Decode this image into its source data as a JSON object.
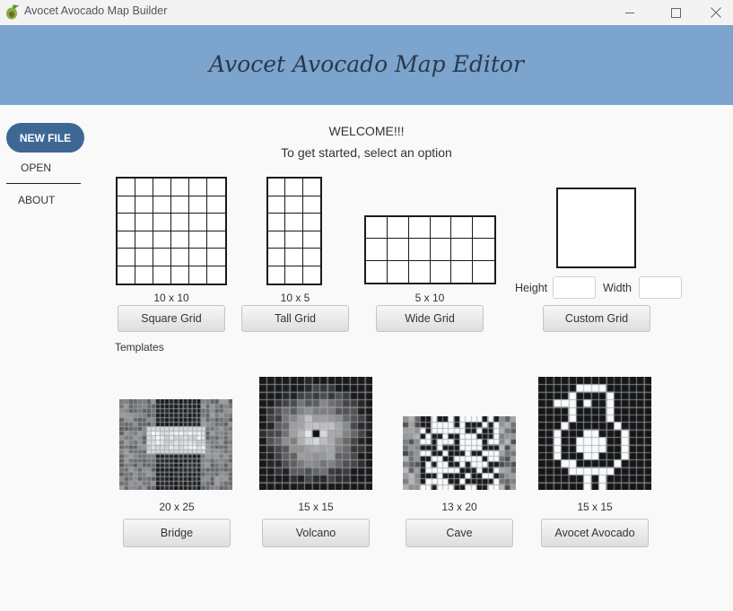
{
  "window": {
    "title": "Avocet Avocado Map Builder",
    "controls": [
      "minimize",
      "maximize",
      "close"
    ]
  },
  "banner": {
    "title": "Avocet Avocado Map Editor"
  },
  "sidebar": {
    "new_file": "NEW FILE",
    "open": "OPEN",
    "about": "ABOUT"
  },
  "main": {
    "welcome": "WELCOME!!!",
    "subtitle": "To get started, select an option",
    "presets": [
      {
        "size": "10 x 10",
        "button": "Square Grid",
        "cols": 6,
        "rows": 6
      },
      {
        "size": "10 x 5",
        "button": "Tall Grid",
        "cols": 3,
        "rows": 6
      },
      {
        "size": "5 x 10",
        "button": "Wide Grid",
        "cols": 6,
        "rows": 3
      }
    ],
    "custom": {
      "height_label": "Height",
      "height_value": "",
      "width_label": "Width",
      "width_value": "",
      "button": "Custom Grid"
    },
    "templates_label": "Templates",
    "templates": [
      {
        "size": "20 x 25",
        "button": "Bridge"
      },
      {
        "size": "15 x 15",
        "button": "Volcano"
      },
      {
        "size": "13 x 20",
        "button": "Cave"
      },
      {
        "size": "15 x 15",
        "button": "Avocet Avocado"
      }
    ]
  },
  "colors": {
    "banner": "#7ca4cc",
    "primary_button": "#3f6796",
    "title_text": "#283a4f"
  }
}
